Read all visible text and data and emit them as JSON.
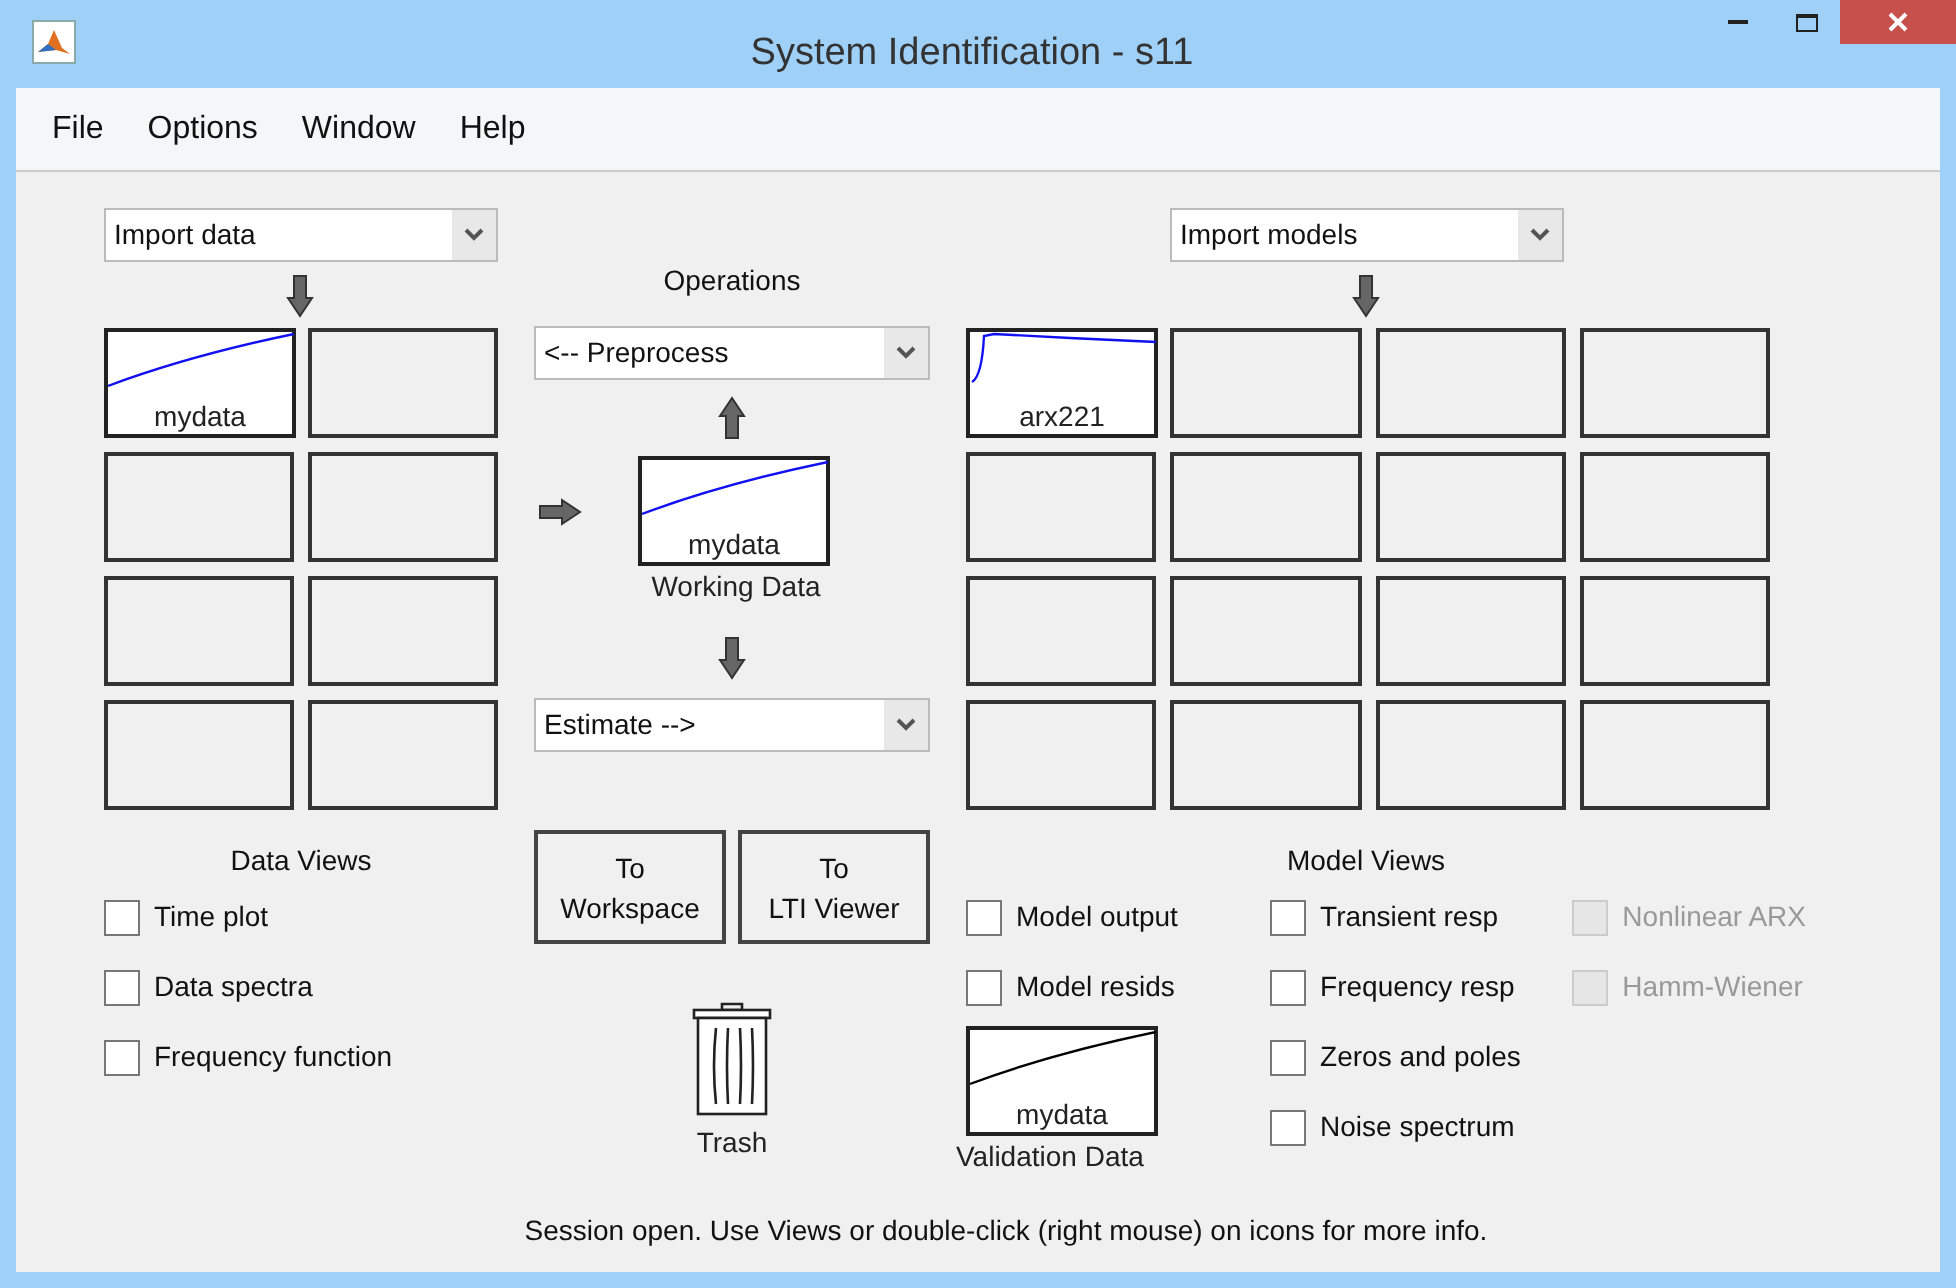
{
  "window": {
    "title": "System Identification - s11"
  },
  "menu": [
    "File",
    "Options",
    "Window",
    "Help"
  ],
  "data_panel": {
    "dropdown": "Import data",
    "tiles": [
      {
        "kind": "data",
        "label": "mydata"
      },
      {
        "kind": "empty"
      },
      {
        "kind": "empty"
      },
      {
        "kind": "empty"
      },
      {
        "kind": "empty"
      },
      {
        "kind": "empty"
      },
      {
        "kind": "empty"
      },
      {
        "kind": "empty"
      }
    ]
  },
  "operations": {
    "title": "Operations",
    "preprocess": "<-- Preprocess",
    "working_data": {
      "kind": "data",
      "label": "mydata",
      "caption": "Working Data"
    },
    "estimate": "Estimate -->",
    "buttons": [
      {
        "lines": [
          "To",
          "Workspace"
        ]
      },
      {
        "lines": [
          "To",
          "LTI Viewer"
        ]
      }
    ],
    "trash": "Trash"
  },
  "model_panel": {
    "dropdown": "Import models",
    "tiles": [
      {
        "kind": "model",
        "label": "arx221"
      },
      {
        "kind": "empty"
      },
      {
        "kind": "empty"
      },
      {
        "kind": "empty"
      },
      {
        "kind": "empty"
      },
      {
        "kind": "empty"
      },
      {
        "kind": "empty"
      },
      {
        "kind": "empty"
      },
      {
        "kind": "empty"
      },
      {
        "kind": "empty"
      },
      {
        "kind": "empty"
      },
      {
        "kind": "empty"
      },
      {
        "kind": "empty"
      },
      {
        "kind": "empty"
      },
      {
        "kind": "empty"
      },
      {
        "kind": "empty"
      }
    ]
  },
  "data_views": {
    "title": "Data Views",
    "options": [
      {
        "label": "Time plot",
        "checked": false,
        "disabled": false
      },
      {
        "label": "Data spectra",
        "checked": false,
        "disabled": false
      },
      {
        "label": "Frequency function",
        "checked": false,
        "disabled": false
      }
    ]
  },
  "model_views": {
    "title": "Model Views",
    "column_1": [
      {
        "label": "Model output",
        "checked": false,
        "disabled": false
      },
      {
        "label": "Model resids",
        "checked": false,
        "disabled": false
      }
    ],
    "validation_data": {
      "kind": "validation",
      "label": "mydata",
      "caption": "Validation Data"
    },
    "column_2": [
      {
        "label": "Transient resp",
        "checked": false,
        "disabled": false
      },
      {
        "label": "Frequency resp",
        "checked": false,
        "disabled": false
      },
      {
        "label": "Zeros and poles",
        "checked": false,
        "disabled": false
      },
      {
        "label": "Noise spectrum",
        "checked": false,
        "disabled": false
      }
    ],
    "column_3": [
      {
        "label": "Nonlinear ARX",
        "checked": false,
        "disabled": true
      },
      {
        "label": "Hamm-Wiener",
        "checked": false,
        "disabled": true
      }
    ]
  },
  "status_bar": "Session open. Use Views or double-click (right mouse) on icons for more info."
}
